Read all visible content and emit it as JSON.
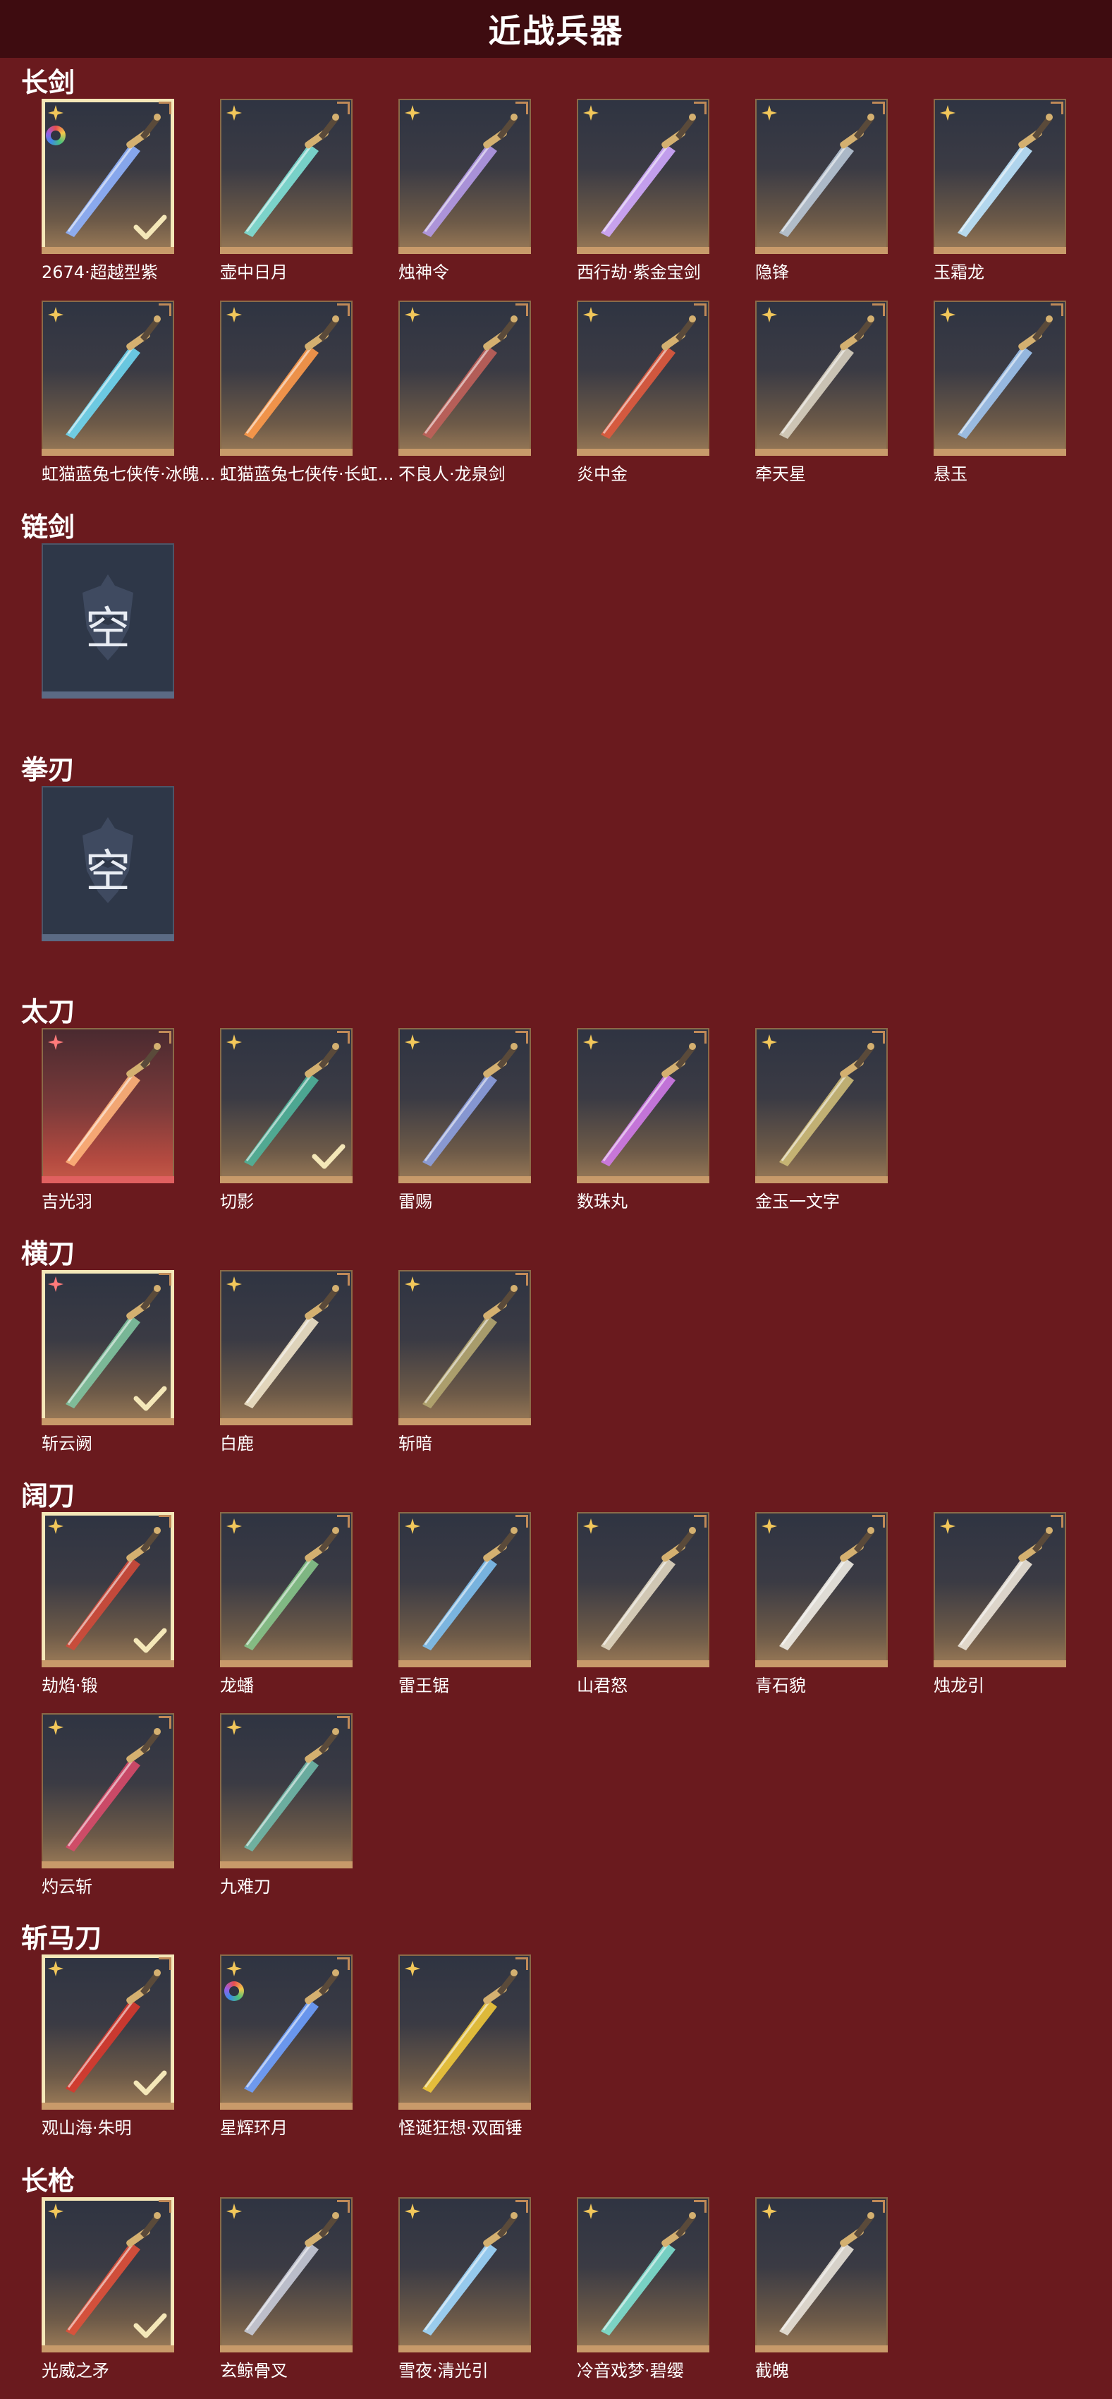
{
  "header": {
    "title": "近战兵器"
  },
  "categories": [
    {
      "label": "长剑",
      "items": [
        {
          "name": "2674·超越型紫",
          "equipped": true,
          "ring": true,
          "color": "#8fb2ff"
        },
        {
          "name": "壶中日月",
          "color": "#7ee1d7"
        },
        {
          "name": "烛神令",
          "color": "#b49ae8"
        },
        {
          "name": "西行劫·紫金宝剑",
          "color": "#d0a8ff"
        },
        {
          "name": "隐锋",
          "color": "#b8c6d6"
        },
        {
          "name": "玉霜龙",
          "color": "#bde6ff"
        },
        {
          "name": "虹猫蓝兔七侠传·冰魄...",
          "color": "#6fd7f2"
        },
        {
          "name": "虹猫蓝兔七侠传·长虹...",
          "color": "#ff9a4a"
        },
        {
          "name": "不良人·龙泉剑",
          "color": "#c0605a"
        },
        {
          "name": "炎中金",
          "color": "#e05a3e"
        },
        {
          "name": "牵天星",
          "color": "#d8d0c0"
        },
        {
          "name": "悬玉",
          "color": "#9ec4f0"
        }
      ]
    },
    {
      "label": "链剑",
      "empty": true,
      "empty_text": "空"
    },
    {
      "label": "拳刃",
      "empty": true,
      "empty_text": "空"
    },
    {
      "label": "太刀",
      "items": [
        {
          "name": "吉光羽",
          "red": true,
          "color": "#ffb37a"
        },
        {
          "name": "切影",
          "equipped_check": true,
          "color": "#4fb39a"
        },
        {
          "name": "雷赐",
          "color": "#8da0e0"
        },
        {
          "name": "数珠丸",
          "color": "#d07ae8"
        },
        {
          "name": "金玉一文字",
          "color": "#cdbb78"
        }
      ]
    },
    {
      "label": "横刀",
      "items": [
        {
          "name": "斩云阙",
          "equipped": true,
          "red_star": true,
          "color": "#7fc4a0"
        },
        {
          "name": "白鹿",
          "color": "#efe3c8"
        },
        {
          "name": "斩暗",
          "color": "#b4a670"
        }
      ]
    },
    {
      "label": "阔刀",
      "items": [
        {
          "name": "劫焰·锻",
          "equipped": true,
          "color": "#d04a3a"
        },
        {
          "name": "龙蟠",
          "color": "#86c48a"
        },
        {
          "name": "雷王锯",
          "color": "#7ec0f0"
        },
        {
          "name": "山君怒",
          "color": "#e0d6c0"
        },
        {
          "name": "青石貌",
          "color": "#f0ece4"
        },
        {
          "name": "烛龙引",
          "color": "#ece4d8"
        },
        {
          "name": "灼云斩",
          "color": "#d84a6a"
        },
        {
          "name": "九难刀",
          "color": "#6fb8a8"
        }
      ]
    },
    {
      "label": "斩马刀",
      "items": [
        {
          "name": "观山海·朱明",
          "equipped": true,
          "color": "#d8382e"
        },
        {
          "name": "星辉环月",
          "ring": true,
          "color": "#6ea0ff"
        },
        {
          "name": "怪诞狂想·双面锤",
          "color": "#f0c83a"
        }
      ]
    },
    {
      "label": "长枪",
      "items": [
        {
          "name": "光威之矛",
          "equipped": true,
          "color": "#e0503a"
        },
        {
          "name": "玄鲸骨叉",
          "color": "#c8cbd8"
        },
        {
          "name": "雪夜·清光引",
          "color": "#9fd8ff"
        },
        {
          "name": "冷音戏梦·碧缨",
          "color": "#7de0d0"
        },
        {
          "name": "截魄",
          "color": "#e8e2d8"
        }
      ]
    }
  ]
}
